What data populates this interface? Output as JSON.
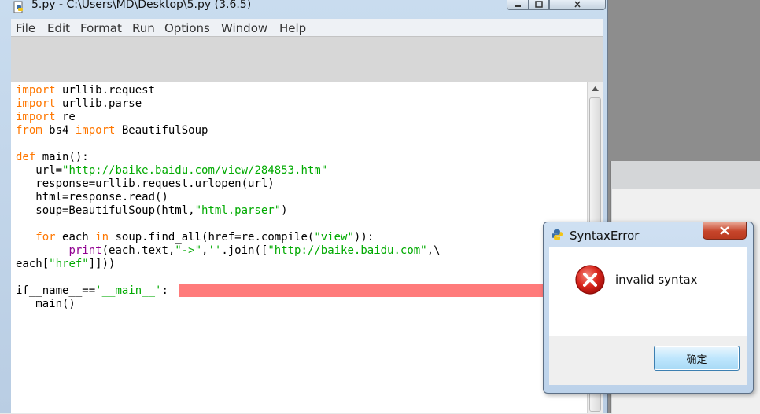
{
  "window": {
    "title": "5.py - C:\\Users\\MD\\Desktop\\5.py (3.6.5)"
  },
  "menu": {
    "items": [
      "File",
      "Edit",
      "Format",
      "Run",
      "Options",
      "Window",
      "Help"
    ]
  },
  "editor": {
    "code_lines": [
      "import urllib.request",
      "import urllib.parse",
      "import re",
      "from bs4 import BeautifulSoup",
      "",
      "def main():",
      "   url=\"http://baike.baidu.com/view/284853.htm\"",
      "   response=urllib.request.urlopen(url)",
      "   html=response.read()",
      "   soup=BeautifulSoup(html,\"html.parser\")",
      "",
      "   for each in soup.find_all(href=re.compile(\"view\")):",
      "        print(each.text,\"->\",''.join([\"http://baike.baidu.com\",\\",
      "each[\"href\"]]))",
      "",
      "if__name__=='__main__':",
      "   main()"
    ],
    "error_line_index": 15
  },
  "dialog": {
    "title": "SyntaxError",
    "message": "invalid syntax",
    "ok_label": "确定",
    "icon": "error-x-icon"
  },
  "colors": {
    "keyword": "#ff7700",
    "builtin": "#900090",
    "string": "#00aa00",
    "error_highlight": "#ff7b7b"
  }
}
